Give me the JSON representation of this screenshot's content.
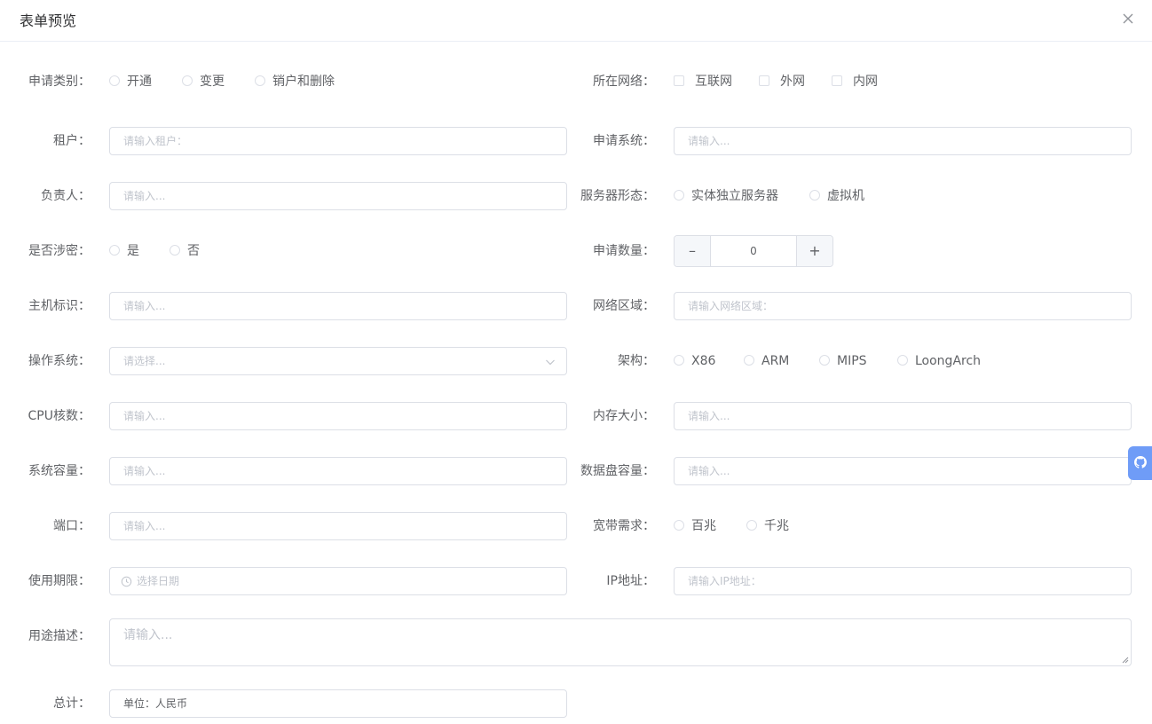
{
  "dialog": {
    "title": "表单预览"
  },
  "form": {
    "apply_type": {
      "label": "申请类别：",
      "options": [
        "开通",
        "变更",
        "销户和删除"
      ]
    },
    "network": {
      "label": "所在网络：",
      "options": [
        "互联网",
        "外网",
        "内网"
      ]
    },
    "tenant": {
      "label": "租户：",
      "placeholder": "请输入租户："
    },
    "system": {
      "label": "申请系统：",
      "placeholder": "请输入..."
    },
    "owner": {
      "label": "负责人：",
      "placeholder": "请输入..."
    },
    "server_type": {
      "label": "服务器形态：",
      "options": [
        "实体独立服务器",
        "虚拟机"
      ]
    },
    "classified": {
      "label": "是否涉密：",
      "options": [
        "是",
        "否"
      ]
    },
    "quantity": {
      "label": "申请数量：",
      "value": "0",
      "dec": "–",
      "inc": "+"
    },
    "host_id": {
      "label": "主机标识：",
      "placeholder": "请输入..."
    },
    "zone": {
      "label": "网络区域：",
      "placeholder": "请输入网络区域："
    },
    "os": {
      "label": "操作系统：",
      "placeholder": "请选择..."
    },
    "arch": {
      "label": "架构：",
      "options": [
        "X86",
        "ARM",
        "MIPS",
        "LoongArch"
      ]
    },
    "cpu": {
      "label": "CPU核数：",
      "placeholder": "请输入..."
    },
    "memory": {
      "label": "内存大小：",
      "placeholder": "请输入..."
    },
    "sys_disk": {
      "label": "系统容量：",
      "placeholder": "请输入..."
    },
    "data_disk": {
      "label": "数据盘容量：",
      "placeholder": "请输入..."
    },
    "port": {
      "label": "端口：",
      "placeholder": "请输入..."
    },
    "bandwidth": {
      "label": "宽带需求：",
      "options": [
        "百兆",
        "千兆"
      ]
    },
    "period": {
      "label": "使用期限：",
      "placeholder": "选择日期"
    },
    "ip": {
      "label": "IP地址：",
      "placeholder": "请输入IP地址："
    },
    "purpose": {
      "label": "用途描述：",
      "placeholder": "请输入..."
    },
    "total": {
      "label": "总计：",
      "value": "单位：人民币"
    }
  },
  "colors": {
    "accent": "#6f9cf7",
    "border": "#dcdfe6",
    "placeholder": "#c0c4cc",
    "text": "#606266"
  },
  "icons": {
    "close": "close-icon",
    "chevron": "chevron-down-icon",
    "clock": "clock-icon",
    "side": "github-icon"
  }
}
